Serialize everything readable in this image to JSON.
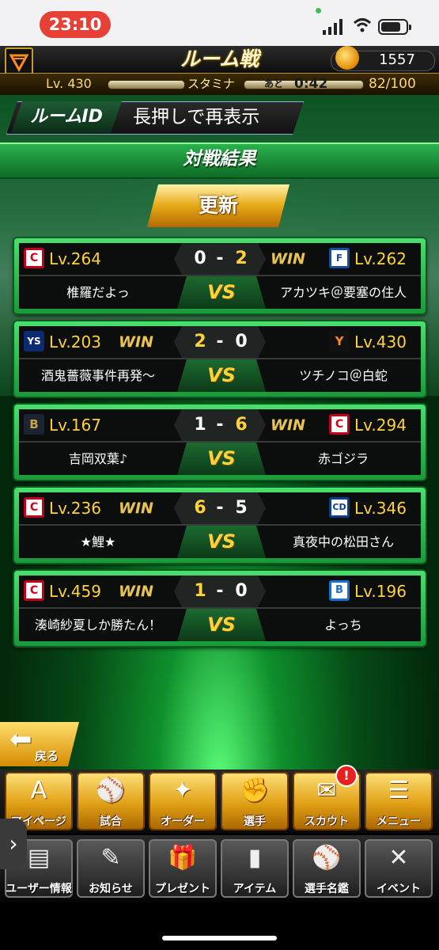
{
  "status_bar": {
    "time": "23:10"
  },
  "header": {
    "title": "ルーム戦",
    "coins": "1557",
    "level": "Lv. 430",
    "stamina_label": "スタミナ",
    "remaining_label": "あと",
    "timer": "0:42",
    "stamina": "82/100"
  },
  "room": {
    "id_label": "ルームID",
    "id_value": "長押しで再表示"
  },
  "results": {
    "title": "対戦結果",
    "update_label": "更新",
    "vs_label": "VS",
    "win_label": "WIN",
    "dash": "-",
    "matches": [
      {
        "left_level": "Lv.264",
        "left_name": "椎羅だよっ",
        "left_score": "0",
        "right_score": "2",
        "right_level": "Lv.262",
        "right_name": "アカツキ＠要塞の住人",
        "left_team_icon": "C",
        "right_team_icon": "F"
      },
      {
        "left_level": "Lv.203",
        "left_name": "酒鬼薔薇事件再発〜",
        "left_score": "2",
        "right_score": "0",
        "right_level": "Lv.430",
        "right_name": "ツチノコ＠白蛇",
        "left_team_icon": "YS",
        "right_team_icon": "Y"
      },
      {
        "left_level": "Lv.167",
        "left_name": "吉岡双葉♪",
        "left_score": "1",
        "right_score": "6",
        "right_level": "Lv.294",
        "right_name": "赤ゴジラ",
        "left_team_icon": "B",
        "right_team_icon": "C"
      },
      {
        "left_level": "Lv.236",
        "left_name": "★鯉★",
        "left_score": "6",
        "right_score": "5",
        "right_level": "Lv.346",
        "right_name": "真夜中の松田さん",
        "left_team_icon": "C",
        "right_team_icon": "CD"
      },
      {
        "left_level": "Lv.459",
        "left_name": "湊崎紗夏しか勝たん！",
        "left_score": "1",
        "right_score": "0",
        "right_level": "Lv.196",
        "right_name": "よっち",
        "left_team_icon": "C",
        "right_team_icon": "B"
      }
    ]
  },
  "back_label": "戻る",
  "nav_row1": [
    "マイページ",
    "試合",
    "オーダー",
    "選手",
    "スカウト",
    "メニュー"
  ],
  "nav_row2": [
    "ユーザー情報",
    "お知らせ",
    "プレゼント",
    "アイテム",
    "選手名鑑",
    "イベント"
  ],
  "badge": "!",
  "icons": [
    "logo-icon",
    "coin-icon",
    "home-icon",
    "stadium-icon",
    "order-icon",
    "player-icon",
    "scout-icon",
    "menu-icon",
    "user-icon",
    "news-icon",
    "gift-icon",
    "item-icon",
    "book-icon",
    "event-icon"
  ]
}
